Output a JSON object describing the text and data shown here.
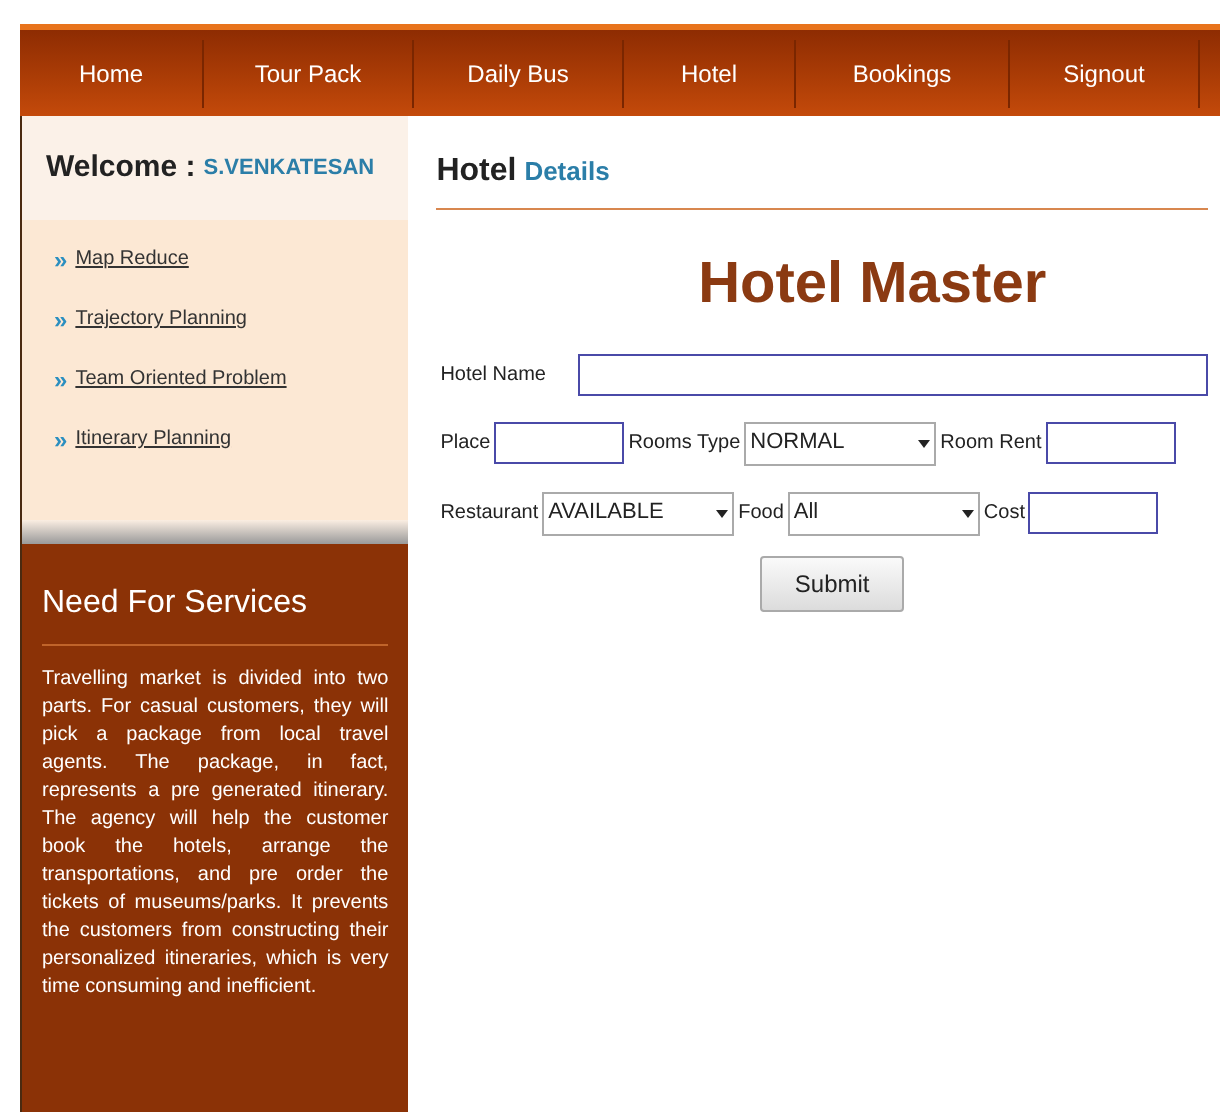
{
  "nav": [
    {
      "label": "Home"
    },
    {
      "label": "Tour Pack"
    },
    {
      "label": "Daily Bus"
    },
    {
      "label": "Hotel"
    },
    {
      "label": "Bookings"
    },
    {
      "label": "Signout"
    }
  ],
  "sidebar": {
    "welcome_label": "Welcome :",
    "user": "S.VENKATESAN",
    "links": [
      {
        "marker": "»",
        "label": "Map Reduce"
      },
      {
        "marker": "»",
        "label": "Trajectory Planning"
      },
      {
        "marker": "»",
        "label": "Team Oriented Problem"
      },
      {
        "marker": "»",
        "label": "Itinerary Planning"
      }
    ],
    "services": {
      "title": "Need For Services",
      "text": "Travelling market is divided into two parts. For casual customers, they will pick a package from local travel agents. The package, in fact, represents a pre generated itinerary. The agency will help the customer book the hotels, arrange the transportations, and pre order the tickets of museums/parks. It prevents the customers from constructing their personalized itineraries, which is very time consuming and inefficient."
    }
  },
  "section": {
    "title": "Hotel",
    "subtitle": "Details"
  },
  "form": {
    "title": "Hotel Master",
    "rows": [
      [
        {
          "kind": "longtext",
          "label": "Hotel Name"
        }
      ],
      [
        {
          "kind": "text",
          "label": "Place"
        },
        {
          "kind": "select",
          "label": "Rooms Type",
          "value": "NORMAL"
        },
        {
          "kind": "text",
          "label": "Room Rent"
        }
      ],
      [
        {
          "kind": "select",
          "label": "Restaurant",
          "value": "AVAILABLE"
        },
        {
          "kind": "select",
          "label": "Food",
          "value": "All"
        },
        {
          "kind": "text",
          "label": "Cost"
        }
      ]
    ],
    "submit": "Submit"
  }
}
